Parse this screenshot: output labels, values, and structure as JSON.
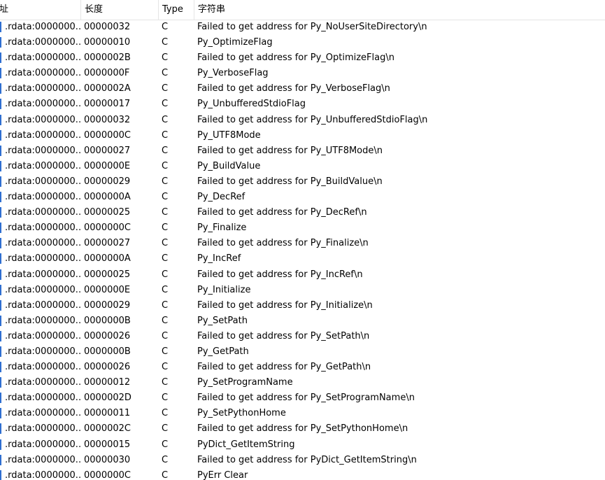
{
  "columns": {
    "address": "址",
    "length": "长度",
    "type": "Type",
    "string": "字符串"
  },
  "rows": [
    {
      "address": ".rdata:0000000...",
      "length": "00000032",
      "type": "C",
      "string": "Failed to get address for Py_NoUserSiteDirectory\\n"
    },
    {
      "address": ".rdata:0000000...",
      "length": "00000010",
      "type": "C",
      "string": "Py_OptimizeFlag"
    },
    {
      "address": ".rdata:0000000...",
      "length": "0000002B",
      "type": "C",
      "string": "Failed to get address for Py_OptimizeFlag\\n"
    },
    {
      "address": ".rdata:0000000...",
      "length": "0000000F",
      "type": "C",
      "string": "Py_VerboseFlag"
    },
    {
      "address": ".rdata:0000000...",
      "length": "0000002A",
      "type": "C",
      "string": "Failed to get address for Py_VerboseFlag\\n"
    },
    {
      "address": ".rdata:0000000...",
      "length": "00000017",
      "type": "C",
      "string": "Py_UnbufferedStdioFlag"
    },
    {
      "address": ".rdata:0000000...",
      "length": "00000032",
      "type": "C",
      "string": "Failed to get address for Py_UnbufferedStdioFlag\\n"
    },
    {
      "address": ".rdata:0000000...",
      "length": "0000000C",
      "type": "C",
      "string": "Py_UTF8Mode"
    },
    {
      "address": ".rdata:0000000...",
      "length": "00000027",
      "type": "C",
      "string": "Failed to get address for Py_UTF8Mode\\n"
    },
    {
      "address": ".rdata:0000000...",
      "length": "0000000E",
      "type": "C",
      "string": "Py_BuildValue"
    },
    {
      "address": ".rdata:0000000...",
      "length": "00000029",
      "type": "C",
      "string": "Failed to get address for Py_BuildValue\\n"
    },
    {
      "address": ".rdata:0000000...",
      "length": "0000000A",
      "type": "C",
      "string": "Py_DecRef"
    },
    {
      "address": ".rdata:0000000...",
      "length": "00000025",
      "type": "C",
      "string": "Failed to get address for Py_DecRef\\n"
    },
    {
      "address": ".rdata:0000000...",
      "length": "0000000C",
      "type": "C",
      "string": "Py_Finalize"
    },
    {
      "address": ".rdata:0000000...",
      "length": "00000027",
      "type": "C",
      "string": "Failed to get address for Py_Finalize\\n"
    },
    {
      "address": ".rdata:0000000...",
      "length": "0000000A",
      "type": "C",
      "string": "Py_IncRef"
    },
    {
      "address": ".rdata:0000000...",
      "length": "00000025",
      "type": "C",
      "string": "Failed to get address for Py_IncRef\\n"
    },
    {
      "address": ".rdata:0000000...",
      "length": "0000000E",
      "type": "C",
      "string": "Py_Initialize"
    },
    {
      "address": ".rdata:0000000...",
      "length": "00000029",
      "type": "C",
      "string": "Failed to get address for Py_Initialize\\n"
    },
    {
      "address": ".rdata:0000000...",
      "length": "0000000B",
      "type": "C",
      "string": "Py_SetPath"
    },
    {
      "address": ".rdata:0000000...",
      "length": "00000026",
      "type": "C",
      "string": "Failed to get address for Py_SetPath\\n"
    },
    {
      "address": ".rdata:0000000...",
      "length": "0000000B",
      "type": "C",
      "string": "Py_GetPath"
    },
    {
      "address": ".rdata:0000000...",
      "length": "00000026",
      "type": "C",
      "string": "Failed to get address for Py_GetPath\\n"
    },
    {
      "address": ".rdata:0000000...",
      "length": "00000012",
      "type": "C",
      "string": "Py_SetProgramName"
    },
    {
      "address": ".rdata:0000000...",
      "length": "0000002D",
      "type": "C",
      "string": "Failed to get address for Py_SetProgramName\\n"
    },
    {
      "address": ".rdata:0000000...",
      "length": "00000011",
      "type": "C",
      "string": "Py_SetPythonHome"
    },
    {
      "address": ".rdata:0000000...",
      "length": "0000002C",
      "type": "C",
      "string": "Failed to get address for Py_SetPythonHome\\n"
    },
    {
      "address": ".rdata:0000000...",
      "length": "00000015",
      "type": "C",
      "string": "PyDict_GetItemString"
    },
    {
      "address": ".rdata:0000000...",
      "length": "00000030",
      "type": "C",
      "string": "Failed to get address for PyDict_GetItemString\\n"
    },
    {
      "address": ".rdata:0000000...",
      "length": "0000000C",
      "type": "C",
      "string": "PyErr Clear"
    }
  ],
  "colors": {
    "row_marker": "#2f6fd0",
    "grid_line": "#e5e5e5"
  }
}
